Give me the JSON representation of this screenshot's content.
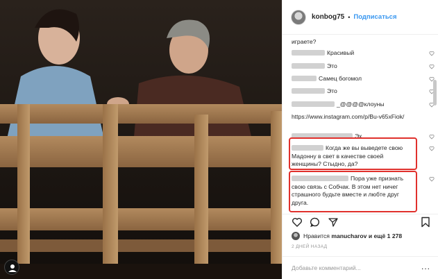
{
  "post": {
    "username": "konbog75",
    "separator": "•",
    "follow_label": "Подписаться"
  },
  "comments": [
    {
      "blur": 0,
      "text": "играете?"
    },
    {
      "blur": 48,
      "text": "Красивый"
    },
    {
      "blur": 48,
      "text": "Это"
    },
    {
      "blur": 36,
      "text": "Самец богомол"
    },
    {
      "blur": 48,
      "text": "Это"
    },
    {
      "blur": 62,
      "text": "_@@@@клоуны"
    },
    {
      "blur": 0,
      "text": "https://www.instagram.com/p/Bu-v65xFiok/"
    },
    {
      "blur": 88,
      "text": "Эх"
    },
    {
      "blur": 46,
      "text": "Когда же вы выведете свою Мадонну в свет в качестве своей женщины? Стыдно, да?"
    },
    {
      "blur": 82,
      "text": "Пора уже признать свою связь с Собчак. В этом нет ничег страшного будьте вместе и любте друг друга."
    }
  ],
  "actions": {
    "like_icon": "heart-outline-icon",
    "comment_icon": "comment-bubble-icon",
    "share_icon": "paper-plane-icon",
    "save_icon": "bookmark-icon"
  },
  "likes": {
    "prefix": "Нравится",
    "user": "manucharov",
    "suffix": "и ещё 1 278"
  },
  "date_label": "2 ДНЕЙ НАЗАД",
  "add_comment": {
    "placeholder": "Добавьте комментарий...",
    "more_label": "..."
  },
  "colors": {
    "accent": "#3897f0",
    "highlight_box": "#e0302c"
  }
}
